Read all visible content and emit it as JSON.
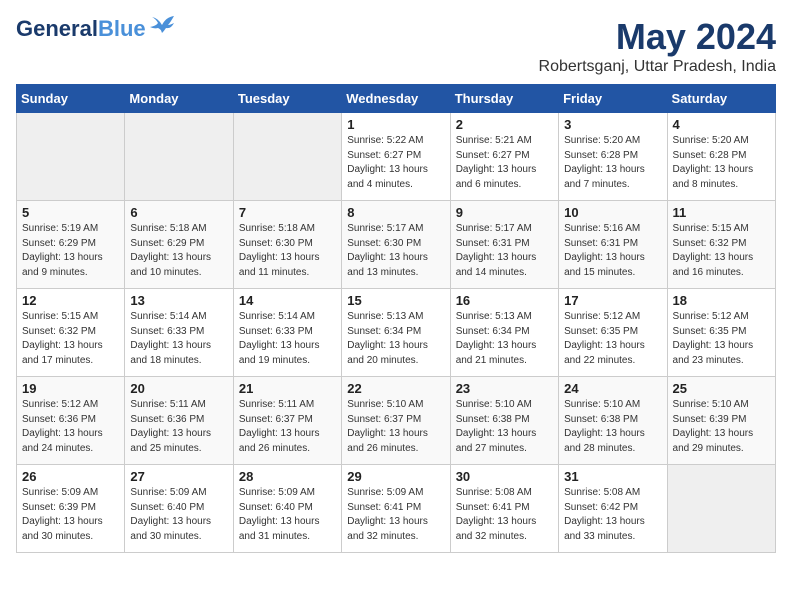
{
  "header": {
    "logo_line1": "General",
    "logo_line2": "Blue",
    "month": "May 2024",
    "location": "Robertsganj, Uttar Pradesh, India"
  },
  "weekdays": [
    "Sunday",
    "Monday",
    "Tuesday",
    "Wednesday",
    "Thursday",
    "Friday",
    "Saturday"
  ],
  "weeks": [
    [
      {
        "day": "",
        "empty": true
      },
      {
        "day": "",
        "empty": true
      },
      {
        "day": "",
        "empty": true
      },
      {
        "day": "1",
        "sunrise": "5:22 AM",
        "sunset": "6:27 PM",
        "daylight": "13 hours and 4 minutes."
      },
      {
        "day": "2",
        "sunrise": "5:21 AM",
        "sunset": "6:27 PM",
        "daylight": "13 hours and 6 minutes."
      },
      {
        "day": "3",
        "sunrise": "5:20 AM",
        "sunset": "6:28 PM",
        "daylight": "13 hours and 7 minutes."
      },
      {
        "day": "4",
        "sunrise": "5:20 AM",
        "sunset": "6:28 PM",
        "daylight": "13 hours and 8 minutes."
      }
    ],
    [
      {
        "day": "5",
        "sunrise": "5:19 AM",
        "sunset": "6:29 PM",
        "daylight": "13 hours and 9 minutes."
      },
      {
        "day": "6",
        "sunrise": "5:18 AM",
        "sunset": "6:29 PM",
        "daylight": "13 hours and 10 minutes."
      },
      {
        "day": "7",
        "sunrise": "5:18 AM",
        "sunset": "6:30 PM",
        "daylight": "13 hours and 11 minutes."
      },
      {
        "day": "8",
        "sunrise": "5:17 AM",
        "sunset": "6:30 PM",
        "daylight": "13 hours and 13 minutes."
      },
      {
        "day": "9",
        "sunrise": "5:17 AM",
        "sunset": "6:31 PM",
        "daylight": "13 hours and 14 minutes."
      },
      {
        "day": "10",
        "sunrise": "5:16 AM",
        "sunset": "6:31 PM",
        "daylight": "13 hours and 15 minutes."
      },
      {
        "day": "11",
        "sunrise": "5:15 AM",
        "sunset": "6:32 PM",
        "daylight": "13 hours and 16 minutes."
      }
    ],
    [
      {
        "day": "12",
        "sunrise": "5:15 AM",
        "sunset": "6:32 PM",
        "daylight": "13 hours and 17 minutes."
      },
      {
        "day": "13",
        "sunrise": "5:14 AM",
        "sunset": "6:33 PM",
        "daylight": "13 hours and 18 minutes."
      },
      {
        "day": "14",
        "sunrise": "5:14 AM",
        "sunset": "6:33 PM",
        "daylight": "13 hours and 19 minutes."
      },
      {
        "day": "15",
        "sunrise": "5:13 AM",
        "sunset": "6:34 PM",
        "daylight": "13 hours and 20 minutes."
      },
      {
        "day": "16",
        "sunrise": "5:13 AM",
        "sunset": "6:34 PM",
        "daylight": "13 hours and 21 minutes."
      },
      {
        "day": "17",
        "sunrise": "5:12 AM",
        "sunset": "6:35 PM",
        "daylight": "13 hours and 22 minutes."
      },
      {
        "day": "18",
        "sunrise": "5:12 AM",
        "sunset": "6:35 PM",
        "daylight": "13 hours and 23 minutes."
      }
    ],
    [
      {
        "day": "19",
        "sunrise": "5:12 AM",
        "sunset": "6:36 PM",
        "daylight": "13 hours and 24 minutes."
      },
      {
        "day": "20",
        "sunrise": "5:11 AM",
        "sunset": "6:36 PM",
        "daylight": "13 hours and 25 minutes."
      },
      {
        "day": "21",
        "sunrise": "5:11 AM",
        "sunset": "6:37 PM",
        "daylight": "13 hours and 26 minutes."
      },
      {
        "day": "22",
        "sunrise": "5:10 AM",
        "sunset": "6:37 PM",
        "daylight": "13 hours and 26 minutes."
      },
      {
        "day": "23",
        "sunrise": "5:10 AM",
        "sunset": "6:38 PM",
        "daylight": "13 hours and 27 minutes."
      },
      {
        "day": "24",
        "sunrise": "5:10 AM",
        "sunset": "6:38 PM",
        "daylight": "13 hours and 28 minutes."
      },
      {
        "day": "25",
        "sunrise": "5:10 AM",
        "sunset": "6:39 PM",
        "daylight": "13 hours and 29 minutes."
      }
    ],
    [
      {
        "day": "26",
        "sunrise": "5:09 AM",
        "sunset": "6:39 PM",
        "daylight": "13 hours and 30 minutes."
      },
      {
        "day": "27",
        "sunrise": "5:09 AM",
        "sunset": "6:40 PM",
        "daylight": "13 hours and 30 minutes."
      },
      {
        "day": "28",
        "sunrise": "5:09 AM",
        "sunset": "6:40 PM",
        "daylight": "13 hours and 31 minutes."
      },
      {
        "day": "29",
        "sunrise": "5:09 AM",
        "sunset": "6:41 PM",
        "daylight": "13 hours and 32 minutes."
      },
      {
        "day": "30",
        "sunrise": "5:08 AM",
        "sunset": "6:41 PM",
        "daylight": "13 hours and 32 minutes."
      },
      {
        "day": "31",
        "sunrise": "5:08 AM",
        "sunset": "6:42 PM",
        "daylight": "13 hours and 33 minutes."
      },
      {
        "day": "",
        "empty": true
      }
    ]
  ]
}
